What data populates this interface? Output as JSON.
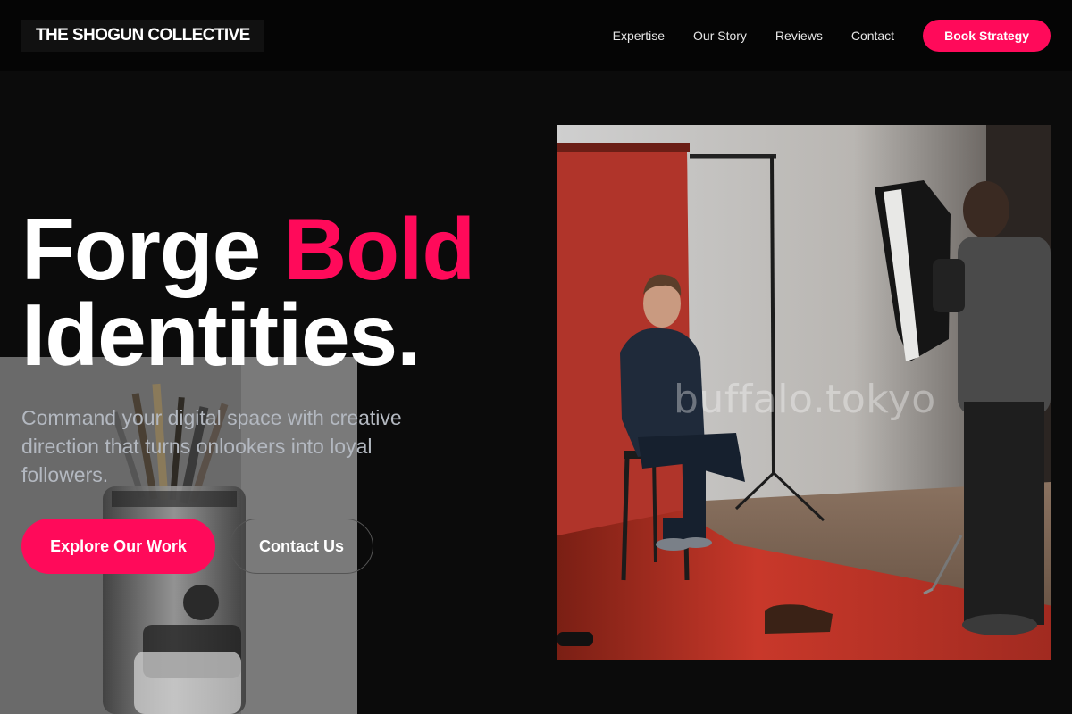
{
  "header": {
    "logo": "THE SHOGUN COLLECTIVE",
    "nav": [
      {
        "label": "Expertise"
      },
      {
        "label": "Our Story"
      },
      {
        "label": "Reviews"
      },
      {
        "label": "Contact"
      }
    ],
    "cta_label": "Book Strategy"
  },
  "hero": {
    "headline_part1": "Forge ",
    "headline_accent": "Bold",
    "headline_part2": "Identities.",
    "subhead": "Command your digital space with creative direction that turns onlookers into loyal followers.",
    "primary_button": "Explore Our Work",
    "secondary_button": "Contact Us"
  },
  "studio_image": {
    "watermark": "buffalo.tokyo"
  },
  "colors": {
    "accent": "#ff0a5a",
    "background": "#0b0b0b",
    "header": "#050505",
    "subhead": "#b3b8c0"
  }
}
